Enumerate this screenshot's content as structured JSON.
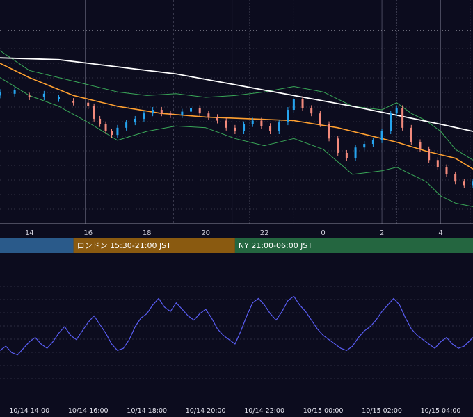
{
  "chart_data": [
    {
      "type": "candlestick",
      "title": "",
      "x_axis_hours": [
        14,
        16,
        18,
        20,
        22,
        0,
        2,
        4
      ],
      "x_tick_labels": [
        "14",
        "16",
        "18",
        "20",
        "22",
        "0",
        "2",
        "4"
      ],
      "x_range_hours": [
        13.0,
        29.1
      ],
      "y_range": [
        0,
        100
      ],
      "colors": {
        "up": "#26a4ef",
        "down": "#f28a7c",
        "ma_long": "#ffffff",
        "ma_short": "#ffa030",
        "bollinger": "#3aa858",
        "grid": "#7d7d90"
      },
      "candles_approx": [
        [
          13.0,
          70,
          72
        ],
        [
          13.5,
          71,
          73
        ],
        [
          14.0,
          70,
          69
        ],
        [
          14.5,
          69,
          71
        ],
        [
          15.0,
          68,
          69
        ],
        [
          15.5,
          67,
          66
        ],
        [
          16.0,
          66,
          64
        ],
        [
          16.2,
          64,
          57
        ],
        [
          16.4,
          57,
          54
        ],
        [
          16.6,
          54,
          50
        ],
        [
          16.8,
          50,
          48
        ],
        [
          17.0,
          48,
          52
        ],
        [
          17.3,
          52,
          55
        ],
        [
          17.6,
          55,
          57
        ],
        [
          17.9,
          57,
          60
        ],
        [
          18.2,
          60,
          62
        ],
        [
          18.5,
          62,
          60
        ],
        [
          18.8,
          60,
          59
        ],
        [
          19.2,
          59,
          61
        ],
        [
          19.5,
          61,
          63
        ],
        [
          19.8,
          63,
          60
        ],
        [
          20.1,
          60,
          58
        ],
        [
          20.4,
          58,
          56
        ],
        [
          20.7,
          56,
          52
        ],
        [
          21.0,
          52,
          50
        ],
        [
          21.3,
          50,
          54
        ],
        [
          21.6,
          54,
          56
        ],
        [
          21.9,
          56,
          53
        ],
        [
          22.2,
          53,
          50
        ],
        [
          22.5,
          50,
          55
        ],
        [
          22.8,
          55,
          62
        ],
        [
          23.0,
          62,
          68
        ],
        [
          23.3,
          68,
          63
        ],
        [
          23.6,
          63,
          60
        ],
        [
          23.9,
          60,
          54
        ],
        [
          24.2,
          54,
          46
        ],
        [
          24.5,
          46,
          38
        ],
        [
          24.8,
          38,
          35
        ],
        [
          25.1,
          35,
          41
        ],
        [
          25.4,
          41,
          43
        ],
        [
          25.7,
          43,
          45
        ],
        [
          26.0,
          45,
          50
        ],
        [
          26.3,
          50,
          60
        ],
        [
          26.5,
          60,
          63
        ],
        [
          26.7,
          63,
          52
        ],
        [
          27.0,
          52,
          44
        ],
        [
          27.3,
          44,
          40
        ],
        [
          27.6,
          40,
          34
        ],
        [
          27.9,
          34,
          30
        ],
        [
          28.2,
          30,
          26
        ],
        [
          28.5,
          26,
          22
        ],
        [
          28.8,
          22,
          20
        ],
        [
          29.1,
          20,
          22
        ]
      ],
      "ma_long": [
        [
          13.0,
          91
        ],
        [
          15.0,
          90
        ],
        [
          17.0,
          86
        ],
        [
          19.0,
          82
        ],
        [
          21.0,
          76
        ],
        [
          23.0,
          70
        ],
        [
          25.0,
          64
        ],
        [
          26.5,
          59
        ],
        [
          28.0,
          54
        ],
        [
          29.1,
          50
        ]
      ],
      "ma_short": [
        [
          13.0,
          88
        ],
        [
          14.0,
          80
        ],
        [
          15.5,
          70
        ],
        [
          17.0,
          64
        ],
        [
          18.5,
          60
        ],
        [
          20.0,
          58
        ],
        [
          21.5,
          57
        ],
        [
          23.0,
          56
        ],
        [
          24.5,
          52
        ],
        [
          25.5,
          48
        ],
        [
          26.5,
          44
        ],
        [
          27.5,
          39
        ],
        [
          28.5,
          35
        ],
        [
          29.1,
          29
        ]
      ],
      "bb_upper": [
        [
          13.0,
          95
        ],
        [
          14.0,
          84
        ],
        [
          15.0,
          80
        ],
        [
          16.0,
          76
        ],
        [
          17.0,
          72
        ],
        [
          18.0,
          70
        ],
        [
          19.0,
          71
        ],
        [
          20.0,
          69
        ],
        [
          21.0,
          70
        ],
        [
          22.0,
          72
        ],
        [
          23.0,
          75
        ],
        [
          24.0,
          72
        ],
        [
          25.0,
          64
        ],
        [
          26.0,
          62
        ],
        [
          26.5,
          66
        ],
        [
          27.0,
          60
        ],
        [
          27.5,
          56
        ],
        [
          28.0,
          50
        ],
        [
          28.5,
          40
        ],
        [
          29.1,
          34
        ]
      ],
      "bb_lower": [
        [
          13.0,
          80
        ],
        [
          14.0,
          70
        ],
        [
          15.0,
          64
        ],
        [
          16.0,
          55
        ],
        [
          17.0,
          45
        ],
        [
          18.0,
          50
        ],
        [
          19.0,
          53
        ],
        [
          20.0,
          52
        ],
        [
          21.0,
          46
        ],
        [
          22.0,
          42
        ],
        [
          23.0,
          46
        ],
        [
          24.0,
          40
        ],
        [
          25.0,
          26
        ],
        [
          26.0,
          28
        ],
        [
          26.5,
          30
        ],
        [
          27.0,
          26
        ],
        [
          27.5,
          22
        ],
        [
          28.0,
          14
        ],
        [
          28.5,
          10
        ],
        [
          29.1,
          8
        ]
      ]
    },
    {
      "type": "line",
      "title": "",
      "x_range_hours": [
        13.0,
        29.1
      ],
      "y_range": [
        0,
        100
      ],
      "color": "#5a5ef5",
      "x_tick_labels": [
        "10/14 14:00",
        "10/14 16:00",
        "10/14 18:00",
        "10/14 20:00",
        "10/14 22:00",
        "10/15 00:00",
        "10/15 02:00",
        "10/15 04:00"
      ],
      "x_tick_hours": [
        14,
        16,
        18,
        20,
        22,
        24,
        26,
        28
      ],
      "points_approx": [
        [
          13.0,
          28
        ],
        [
          13.2,
          32
        ],
        [
          13.4,
          26
        ],
        [
          13.6,
          24
        ],
        [
          13.8,
          30
        ],
        [
          14.0,
          36
        ],
        [
          14.2,
          40
        ],
        [
          14.4,
          34
        ],
        [
          14.6,
          30
        ],
        [
          14.8,
          36
        ],
        [
          15.0,
          44
        ],
        [
          15.2,
          50
        ],
        [
          15.4,
          42
        ],
        [
          15.6,
          38
        ],
        [
          15.8,
          46
        ],
        [
          16.0,
          54
        ],
        [
          16.2,
          60
        ],
        [
          16.4,
          52
        ],
        [
          16.6,
          44
        ],
        [
          16.8,
          34
        ],
        [
          17.0,
          28
        ],
        [
          17.2,
          30
        ],
        [
          17.4,
          38
        ],
        [
          17.6,
          50
        ],
        [
          17.8,
          58
        ],
        [
          18.0,
          62
        ],
        [
          18.2,
          70
        ],
        [
          18.4,
          76
        ],
        [
          18.6,
          68
        ],
        [
          18.8,
          64
        ],
        [
          19.0,
          72
        ],
        [
          19.2,
          66
        ],
        [
          19.4,
          60
        ],
        [
          19.6,
          56
        ],
        [
          19.8,
          62
        ],
        [
          20.0,
          66
        ],
        [
          20.2,
          58
        ],
        [
          20.4,
          48
        ],
        [
          20.6,
          42
        ],
        [
          20.8,
          38
        ],
        [
          21.0,
          34
        ],
        [
          21.2,
          46
        ],
        [
          21.4,
          60
        ],
        [
          21.6,
          72
        ],
        [
          21.8,
          76
        ],
        [
          22.0,
          70
        ],
        [
          22.2,
          62
        ],
        [
          22.4,
          56
        ],
        [
          22.6,
          64
        ],
        [
          22.8,
          74
        ],
        [
          23.0,
          78
        ],
        [
          23.2,
          70
        ],
        [
          23.4,
          64
        ],
        [
          23.6,
          56
        ],
        [
          23.8,
          48
        ],
        [
          24.0,
          42
        ],
        [
          24.2,
          38
        ],
        [
          24.4,
          34
        ],
        [
          24.6,
          30
        ],
        [
          24.8,
          28
        ],
        [
          25.0,
          32
        ],
        [
          25.2,
          40
        ],
        [
          25.4,
          46
        ],
        [
          25.6,
          50
        ],
        [
          25.8,
          56
        ],
        [
          26.0,
          64
        ],
        [
          26.2,
          70
        ],
        [
          26.4,
          76
        ],
        [
          26.6,
          70
        ],
        [
          26.8,
          58
        ],
        [
          27.0,
          48
        ],
        [
          27.2,
          42
        ],
        [
          27.4,
          38
        ],
        [
          27.6,
          34
        ],
        [
          27.8,
          30
        ],
        [
          28.0,
          36
        ],
        [
          28.2,
          40
        ],
        [
          28.4,
          34
        ],
        [
          28.6,
          30
        ],
        [
          28.8,
          32
        ],
        [
          29.1,
          40
        ]
      ]
    }
  ],
  "sessions": [
    {
      "label": "",
      "color": "#2a5a8a",
      "from_hour": 13.0,
      "to_hour": 15.5
    },
    {
      "label": "ロンドン 15:30-21:00 JST",
      "color": "#8a5a10",
      "from_hour": 15.5,
      "to_hour": 21.0
    },
    {
      "label": "NY 21:00-06:00 JST",
      "color": "#246640",
      "from_hour": 21.0,
      "to_hour": 29.1
    }
  ]
}
